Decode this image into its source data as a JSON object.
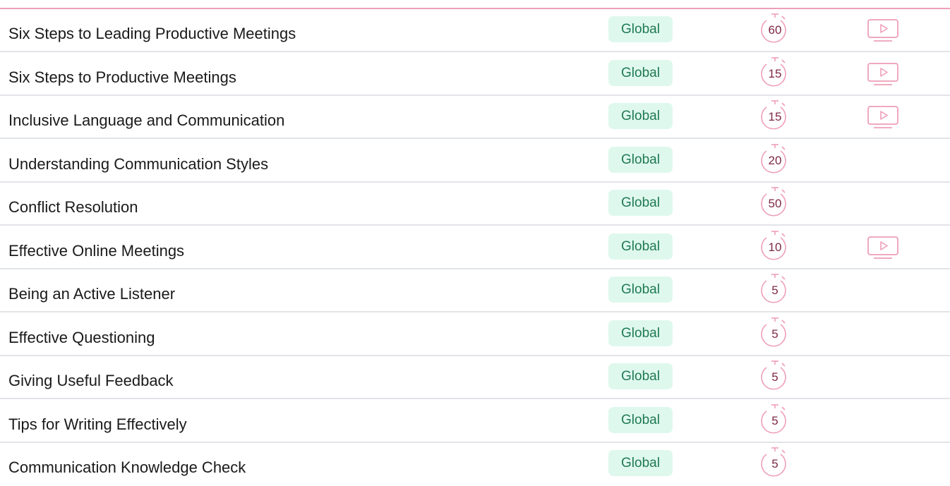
{
  "accent_color": "#ee9fb8",
  "badge_colors": {
    "background": "#dff8ee",
    "text": "#1f7a52"
  },
  "icons": {
    "timer": "stopwatch-icon",
    "video": "video-play-icon"
  },
  "courses": [
    {
      "title": "Six Steps to Leading Productive Meetings",
      "scope": "Global",
      "duration": "60",
      "has_video": true
    },
    {
      "title": "Six Steps to Productive Meetings",
      "scope": "Global",
      "duration": "15",
      "has_video": true
    },
    {
      "title": "Inclusive Language and Communication",
      "scope": "Global",
      "duration": "15",
      "has_video": true
    },
    {
      "title": "Understanding Communication Styles",
      "scope": "Global",
      "duration": "20",
      "has_video": false
    },
    {
      "title": "Conflict Resolution",
      "scope": "Global",
      "duration": "50",
      "has_video": false
    },
    {
      "title": "Effective Online Meetings",
      "scope": "Global",
      "duration": "10",
      "has_video": true
    },
    {
      "title": "Being an Active Listener",
      "scope": "Global",
      "duration": "5",
      "has_video": false
    },
    {
      "title": "Effective Questioning",
      "scope": "Global",
      "duration": "5",
      "has_video": false
    },
    {
      "title": "Giving Useful Feedback",
      "scope": "Global",
      "duration": "5",
      "has_video": false
    },
    {
      "title": "Tips for Writing Effectively",
      "scope": "Global",
      "duration": "5",
      "has_video": false
    },
    {
      "title": "Communication Knowledge Check",
      "scope": "Global",
      "duration": "5",
      "has_video": false
    }
  ]
}
